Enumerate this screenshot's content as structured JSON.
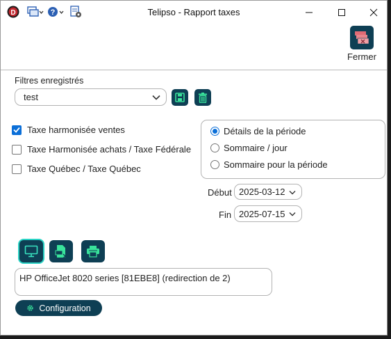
{
  "window": {
    "title": "Telipso - Rapport taxes",
    "buttons": {
      "minimize": "minimize-icon",
      "maximize": "maximize-icon",
      "close": "close-icon"
    }
  },
  "quick_access": {
    "app_icon": "app-logo-icon",
    "items": [
      "layers-icon",
      "help-icon",
      "page-settings-icon"
    ]
  },
  "toolbar": {
    "close_label": "Fermer",
    "close_icon": "report-close-icon"
  },
  "filters": {
    "label": "Filtres enregistrés",
    "selected": "test",
    "save_icon": "save-icon",
    "delete_icon": "trash-icon"
  },
  "checkboxes": [
    {
      "label": "Taxe harmonisée ventes",
      "checked": true
    },
    {
      "label": "Taxe Harmonisée achats / Taxe Fédérale",
      "checked": false
    },
    {
      "label": "Taxe Québec / Taxe Québec",
      "checked": false
    }
  ],
  "radios": [
    {
      "label": "Détails de la période",
      "selected": true
    },
    {
      "label": "Sommaire / jour",
      "selected": false
    },
    {
      "label": "Sommaire pour la période",
      "selected": false
    }
  ],
  "dates": {
    "start_label": "Début",
    "start_value": "2025-03-12",
    "end_label": "Fin",
    "end_value": "2025-07-15"
  },
  "output_buttons": [
    "monitor-icon",
    "export-file-icon",
    "printer-icon"
  ],
  "printer": {
    "text": "HP OfficeJet 8020 series [81EBE8] (redirection de 2)"
  },
  "config": {
    "label": "Configuration",
    "icon": "gear-icon"
  },
  "colors": {
    "accent": "#0e3f54",
    "check": "#0b6fd8",
    "highlight": "#2ad3c5"
  }
}
